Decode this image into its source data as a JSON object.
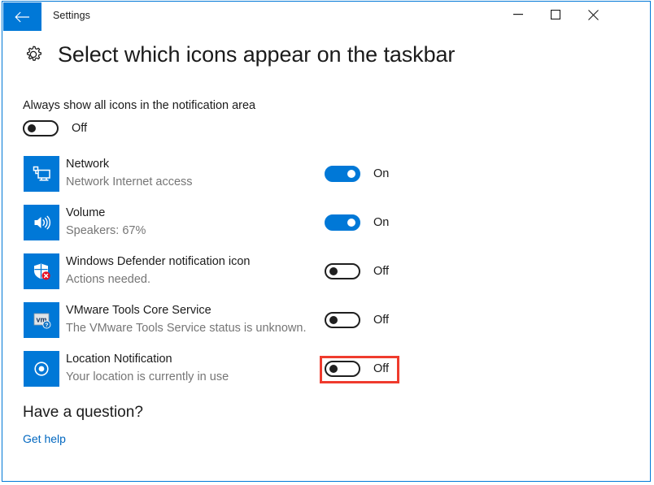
{
  "window": {
    "title": "Settings",
    "accent_color": "#0078d7",
    "border_color": "#0078d7",
    "back_icon": "back-arrow-icon",
    "controls": {
      "minimize": "minimize-icon",
      "maximize": "maximize-icon",
      "close": "close-icon"
    }
  },
  "header": {
    "icon": "gear-icon",
    "title": "Select which icons appear on the taskbar"
  },
  "always_show": {
    "label": "Always show all icons in the notification area",
    "state": "Off",
    "on": false
  },
  "items": [
    {
      "icon": "network-monitor-icon",
      "title": "Network",
      "subtitle": "Network Internet access",
      "state": "On",
      "on": true,
      "highlighted": false
    },
    {
      "icon": "volume-speaker-icon",
      "title": "Volume",
      "subtitle": "Speakers: 67%",
      "state": "On",
      "on": true,
      "highlighted": false
    },
    {
      "icon": "defender-shield-icon",
      "title": "Windows Defender notification icon",
      "subtitle": "Actions needed.",
      "state": "Off",
      "on": false,
      "highlighted": false
    },
    {
      "icon": "vmware-tools-icon",
      "title": "VMware Tools Core Service",
      "subtitle": "The VMware Tools Service status is unknown.",
      "state": "Off",
      "on": false,
      "highlighted": false
    },
    {
      "icon": "location-target-icon",
      "title": "Location Notification",
      "subtitle": "Your location is currently in use",
      "state": "Off",
      "on": false,
      "highlighted": true,
      "highlight_color": "#ef3b2d"
    }
  ],
  "footer": {
    "heading": "Have a question?",
    "link": "Get help",
    "link_color": "#0067c0"
  }
}
